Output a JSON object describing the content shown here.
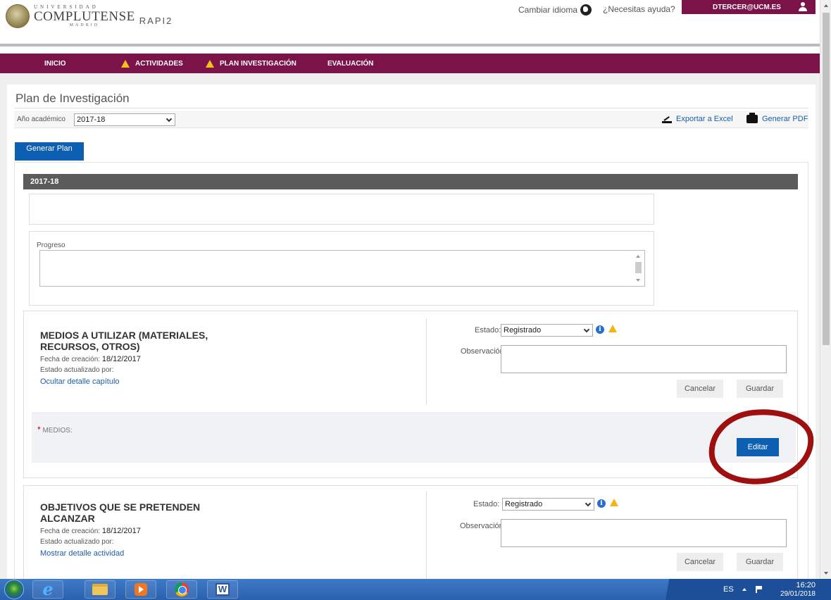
{
  "header": {
    "logo_university": "UNIVERSIDAD",
    "logo_name": "COMPLUTENSE",
    "logo_city": "MADRID",
    "app_name": "RAPI2",
    "change_language": "Cambiar idioma",
    "help": "¿Necesitas ayuda?",
    "user": "DTERCER@UCM.ES"
  },
  "nav": {
    "items": [
      {
        "label": "INICIO",
        "warning": false
      },
      {
        "label": "ACTIVIDADES",
        "warning": true
      },
      {
        "label": "PLAN INVESTIGACIÓN",
        "warning": true
      },
      {
        "label": "EVALUACIÓN",
        "warning": false
      }
    ]
  },
  "page": {
    "title": "Plan de Investigación",
    "year_label": "Año académico",
    "year_value": "2017-18",
    "export_excel": "Exportar a Excel",
    "generate_pdf": "Generar PDF",
    "generate_plan": "Generar Plan",
    "year_bar": "2017-18",
    "progress_label": "Progreso"
  },
  "chapters": [
    {
      "title": "MEDIOS A UTILIZAR (MATERIALES, RECURSOS, OTROS)",
      "created_label": "Fecha de creación:",
      "created_value": "18/12/2017",
      "updated_label": "Estado actualizado por:",
      "link": "Ocultar detalle capítulo",
      "estado_label": "Estado:",
      "estado_value": "Registrado",
      "obs_label": "Observación:",
      "cancel": "Cancelar",
      "save": "Guardar",
      "field_required": "*",
      "field_label": "MEDIOS:",
      "edit": "Editar"
    },
    {
      "title": "OBJETIVOS QUE SE PRETENDEN ALCANZAR",
      "created_label": "Fecha de creación:",
      "created_value": "18/12/2017",
      "updated_label": "Estado actualizado por:",
      "link": "Mostrar detalle actividad",
      "estado_label": "Estado:",
      "estado_value": "Registrado",
      "obs_label": "Observación:",
      "cancel": "Cancelar",
      "save": "Guardar"
    }
  ],
  "taskbar": {
    "language": "ES",
    "time": "16:20",
    "date": "29/01/2018",
    "word_glyph": "W"
  },
  "colors": {
    "brand": "#7b1349",
    "primary_button": "#0d5fb2",
    "annotation": "#9e1010"
  }
}
